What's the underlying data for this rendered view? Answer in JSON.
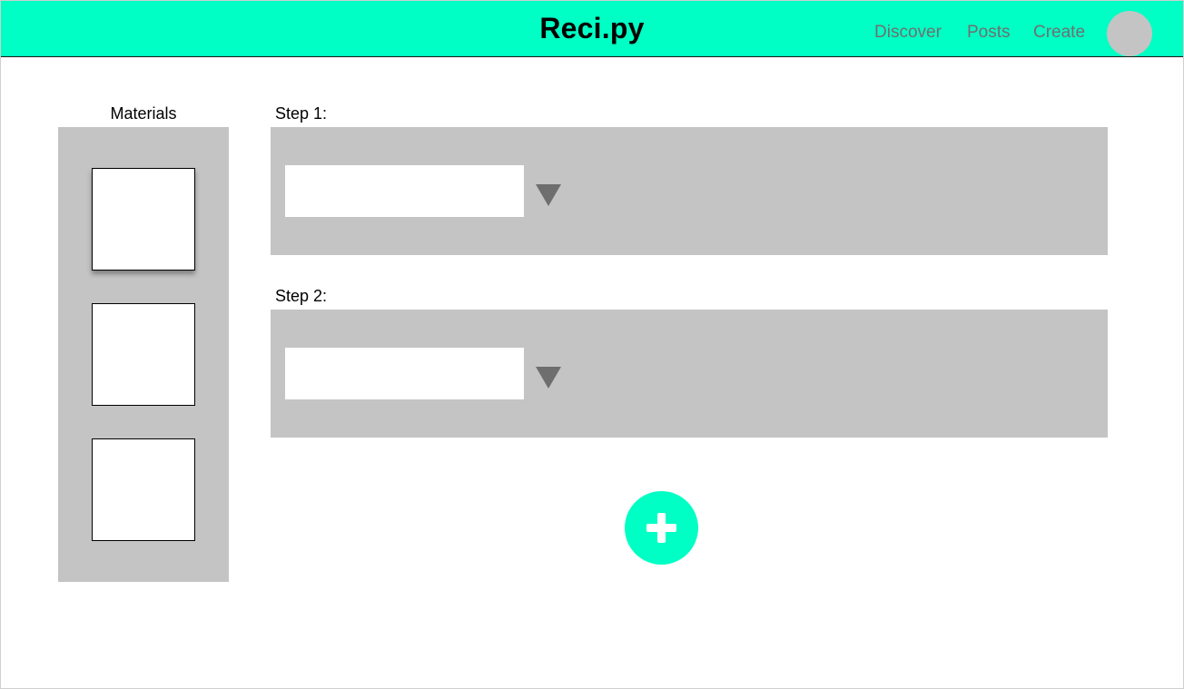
{
  "header": {
    "logo": "Reci.py",
    "nav": {
      "discover": "Discover",
      "posts": "Posts",
      "create": "Create"
    },
    "accent_color": "#00ffc4"
  },
  "materials": {
    "label": "Materials",
    "slot_count": 3
  },
  "steps": [
    {
      "label": "Step 1:",
      "selected_value": ""
    },
    {
      "label": "Step 2:",
      "selected_value": ""
    }
  ],
  "add_step": {
    "icon": "plus-icon"
  },
  "colors": {
    "panel": "#c4c4c4",
    "nav_text": "#6f6f6f",
    "caret": "#6e6e6e"
  }
}
